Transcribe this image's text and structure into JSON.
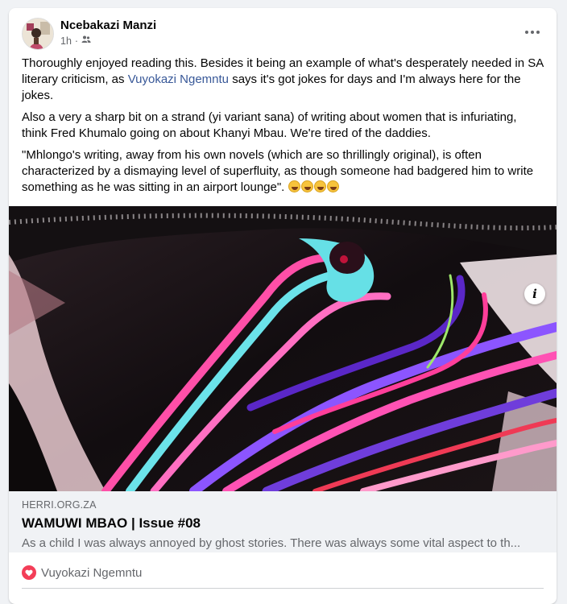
{
  "post": {
    "author": "Ncebakazi Manzi",
    "time": "1h",
    "separator": "·",
    "privacy_icon": "friends-icon",
    "more_icon": "more-options-icon",
    "paragraph1": {
      "before": "Thoroughly enjoyed reading this. Besides it being an example of what's desperately needed in SA literary criticism, as ",
      "mention": "Vuyokazi Ngemntu",
      "after": " says it's got jokes for days and I'm always here for the jokes."
    },
    "paragraph2": "Also a very a sharp bit on a strand (yi variant sana) of writing about women that is infuriating, think Fred Khumalo going on about Khanyi Mbau. We're tired of the daddies.",
    "paragraph3": "\"Mhlongo's writing, away from his own novels (which are so thrillingly original), is often characterized by a dismaying level of superfluity, as though someone had badgered him to write something as he was sitting in an airport lounge\".",
    "emoji_count": 4,
    "emoji_name": "laughing-tears-emoji"
  },
  "link_preview": {
    "domain": "HERRI.ORG.ZA",
    "title": "WAMUWI MBAO | Issue #08",
    "description": "As a child I was always annoyed by ghost stories. There was always some vital aspect to th...",
    "info_label": "i"
  },
  "reactions": {
    "icon": "heart-reaction-icon",
    "names": "Vuyokazi Ngemntu"
  },
  "colors": {
    "mention": "#385898",
    "background": "#f0f2f5",
    "reaction": "#f33e58"
  }
}
